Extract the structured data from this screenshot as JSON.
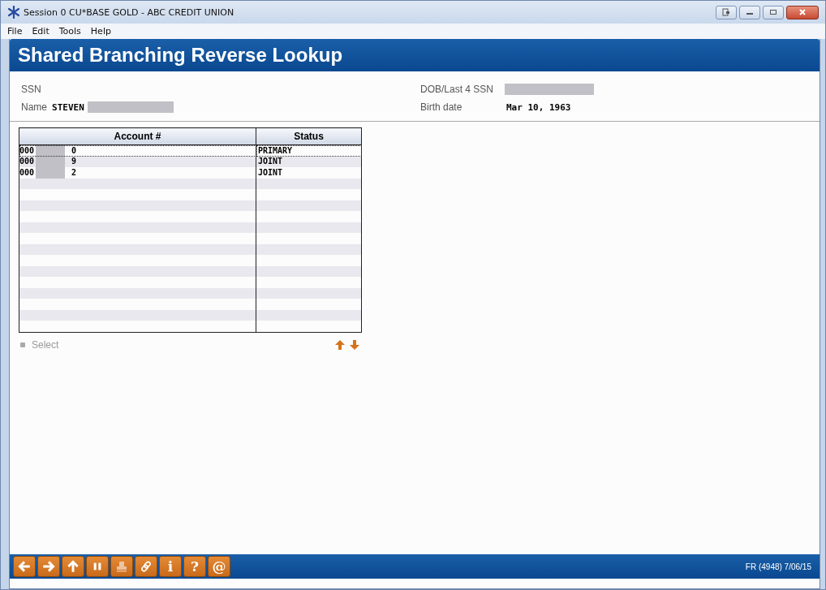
{
  "window": {
    "title": "Session 0 CU*BASE GOLD - ABC CREDIT UNION"
  },
  "menu": [
    "File",
    "Edit",
    "Tools",
    "Help"
  ],
  "header": {
    "title": "Shared Branching Reverse Lookup"
  },
  "fields_left": [
    {
      "label": "SSN"
    },
    {
      "label": "Name",
      "value": "STEVEN",
      "redacted": true
    }
  ],
  "fields_right": [
    {
      "label": "DOB/Last 4 SSN",
      "redacted": true
    },
    {
      "label": "Birth date",
      "value": "Mar 10, 1963"
    }
  ],
  "table": {
    "columns": [
      "Account #",
      "Status"
    ],
    "rows": [
      {
        "account_prefix": "000",
        "account_suffix": "0",
        "status": "PRIMARY",
        "selected": true
      },
      {
        "account_prefix": "000",
        "account_suffix": "9",
        "status": "JOINT",
        "selected": false
      },
      {
        "account_prefix": "000",
        "account_suffix": "2",
        "status": "JOINT",
        "selected": false
      }
    ]
  },
  "actions": [
    {
      "label": "Select",
      "disabled": true
    }
  ],
  "toolbar": [
    {
      "kind": "back",
      "disabled": false
    },
    {
      "kind": "forward",
      "disabled": false
    },
    {
      "kind": "up",
      "disabled": false
    },
    {
      "kind": "pause",
      "disabled": false
    },
    {
      "kind": "print",
      "disabled": true
    },
    {
      "kind": "link",
      "disabled": false
    },
    {
      "kind": "char",
      "label": "i",
      "disabled": false
    },
    {
      "kind": "char",
      "label": "?",
      "disabled": false
    },
    {
      "kind": "char",
      "label": "@",
      "disabled": false
    }
  ],
  "status_bar": {
    "text": "FR (4948) 7/06/15"
  }
}
